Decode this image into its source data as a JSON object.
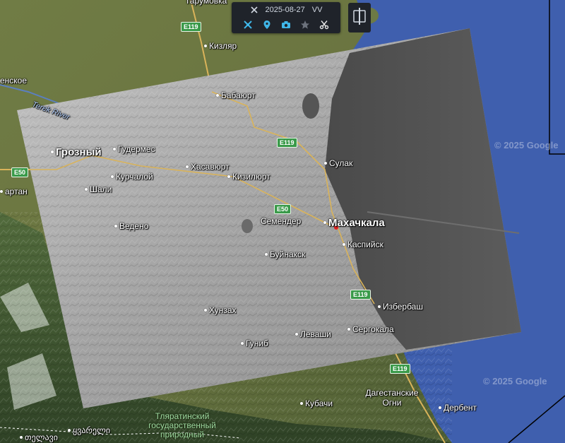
{
  "toolbar": {
    "date": "2025-08-27",
    "polarization": "VV",
    "icons": [
      "close-icon",
      "satellite-icon",
      "location-pin-icon",
      "camera-icon",
      "star-icon",
      "scissors-icon"
    ]
  },
  "split_view": {
    "icon": "split-view-icon"
  },
  "cities": [
    {
      "name": "Кизляр"
    },
    {
      "name": "Бабаюрт"
    },
    {
      "name": "Грозный"
    },
    {
      "name": "Гудермес"
    },
    {
      "name": "Хасавюрт"
    },
    {
      "name": "Курчалой"
    },
    {
      "name": "Кизилюрт"
    },
    {
      "name": "Шали"
    },
    {
      "name": "Сулак"
    },
    {
      "name": "Махачкала"
    },
    {
      "name": "Семендер"
    },
    {
      "name": "Ведено"
    },
    {
      "name": "Каспийск"
    },
    {
      "name": "Буйнакск"
    },
    {
      "name": "Избербаш"
    },
    {
      "name": "Хунзах"
    },
    {
      "name": "Сергокала"
    },
    {
      "name": "Леваши"
    },
    {
      "name": "Гуниб"
    },
    {
      "name": "Дагестанские Огни"
    },
    {
      "name": "Кубачи"
    },
    {
      "name": "Дербент"
    },
    {
      "name": "Тарумовка"
    },
    {
      "name": "енское"
    },
    {
      "name": "артан"
    }
  ],
  "park": "Тляратинский государственный природный",
  "georgian": [
    "ყვარელი",
    "თელავი"
  ],
  "river": "Terek River",
  "roads": [
    "E119",
    "E119",
    "E50",
    "E50",
    "E119",
    "E119"
  ],
  "watermarks": [
    "© 2025 Google",
    "© 2025 Google"
  ],
  "colors": {
    "sea": "#3f5fae",
    "land": "#6d7a45",
    "sar_overlay": "#a9a9a9",
    "sar_sea": "#555555",
    "toolbar_bg": "#1f232a",
    "accent": "#3fb6e8"
  }
}
